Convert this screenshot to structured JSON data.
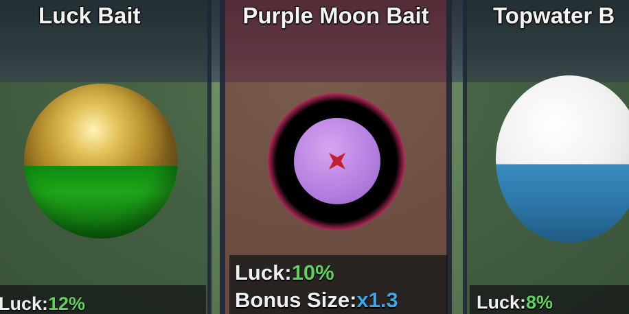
{
  "colors": {
    "luck_value": "#5fd35a",
    "bonus_value": "#3aa7e6",
    "mid_card_tint": "#78283a"
  },
  "cards": [
    {
      "title": "Luck Bait",
      "stats": [
        {
          "label": "Luck:",
          "value": "12%"
        }
      ]
    },
    {
      "title": "Purple Moon Bait",
      "stats": [
        {
          "label": "Luck:",
          "value": "10%"
        },
        {
          "label": "Bonus Size:",
          "value": "x1.3"
        }
      ]
    },
    {
      "title": "Topwater B",
      "stats": [
        {
          "label": "Luck:",
          "value": "8%"
        }
      ]
    }
  ]
}
